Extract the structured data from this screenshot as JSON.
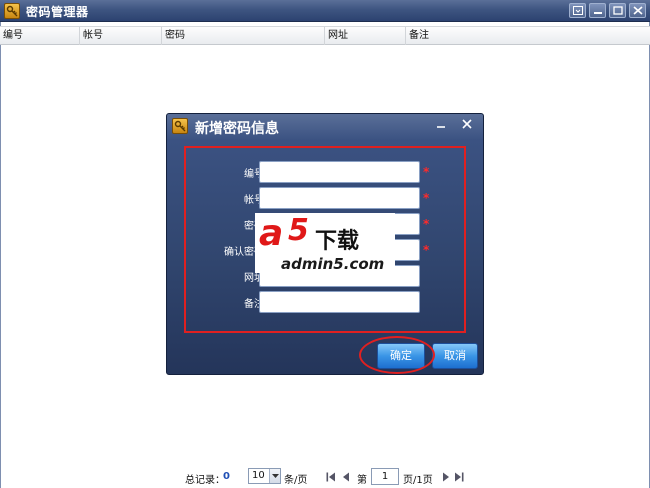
{
  "app": {
    "title": "密码管理器"
  },
  "columns": [
    "编号",
    "帐号",
    "密码",
    "网址",
    "备注"
  ],
  "dialog": {
    "title": "新增密码信息",
    "fields": [
      {
        "label": "编号：",
        "value": "",
        "required": "*"
      },
      {
        "label": "帐号：",
        "value": "",
        "required": "*"
      },
      {
        "label": "密码：",
        "value": "",
        "required": "*"
      },
      {
        "label": "确认密码：",
        "value": "",
        "required": "*"
      },
      {
        "label": "网址：",
        "value": "",
        "required": ""
      },
      {
        "label": "备注：",
        "value": "",
        "required": ""
      }
    ],
    "ok_label": "确定",
    "cancel_label": "取消"
  },
  "watermark": {
    "brand_a": "a",
    "brand_5": "5",
    "brand_cn": "下载",
    "url": "admin5.com"
  },
  "pager": {
    "total_label": "总记录：",
    "total_value": "0",
    "page_size": "10",
    "per_page_label": "条/页",
    "page_prefix": "第",
    "current_page": "1",
    "page_suffix": "页/1页"
  },
  "colors": {
    "accent": "#3a95e6",
    "titlebar": "#3e5581",
    "highlight": "#e02020"
  }
}
